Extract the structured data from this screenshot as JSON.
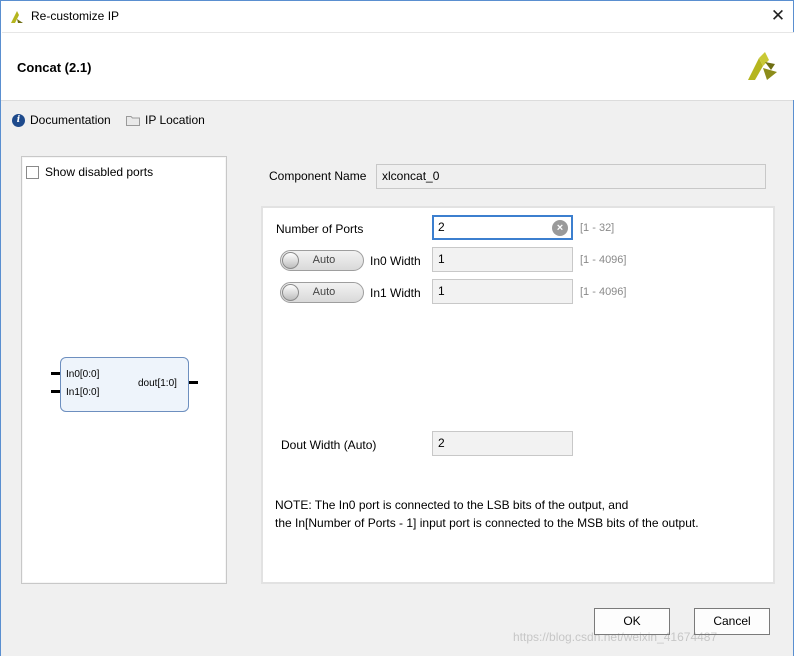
{
  "window": {
    "title": "Re-customize IP",
    "close_glyph": "✕"
  },
  "header": {
    "ip_title": "Concat (2.1)"
  },
  "toolbar": {
    "documentation": "Documentation",
    "ip_location": "IP Location"
  },
  "left_panel": {
    "show_disabled_ports": "Show disabled ports",
    "block": {
      "in0": "In0[0:0]",
      "in1": "In1[0:0]",
      "out": "dout[1:0]"
    }
  },
  "component": {
    "label": "Component Name",
    "value": "xlconcat_0"
  },
  "form": {
    "num_ports": {
      "label": "Number of Ports",
      "value": "2",
      "range": "[1 - 32]"
    },
    "in0_width": {
      "mode": "Auto",
      "label": "In0 Width",
      "value": "1",
      "range": "[1 - 4096]"
    },
    "in1_width": {
      "mode": "Auto",
      "label": "In1 Width",
      "value": "1",
      "range": "[1 - 4096]"
    },
    "dout_width": {
      "label": "Dout Width (Auto)",
      "value": "2"
    },
    "note_line1": "NOTE: The In0 port is connected to the LSB bits of the output, and",
    "note_line2": "the In[Number of Ports - 1] input port is connected to the MSB bits of the output."
  },
  "buttons": {
    "ok": "OK",
    "cancel": "Cancel"
  },
  "watermark": "https://blog.csdn.net/weixin_41674487",
  "colors": {
    "logo_green": "#b5b51e",
    "logo_dark": "#6e6e12",
    "accent_blue": "#3c7fcf",
    "info_blue": "#1e4a8c"
  }
}
